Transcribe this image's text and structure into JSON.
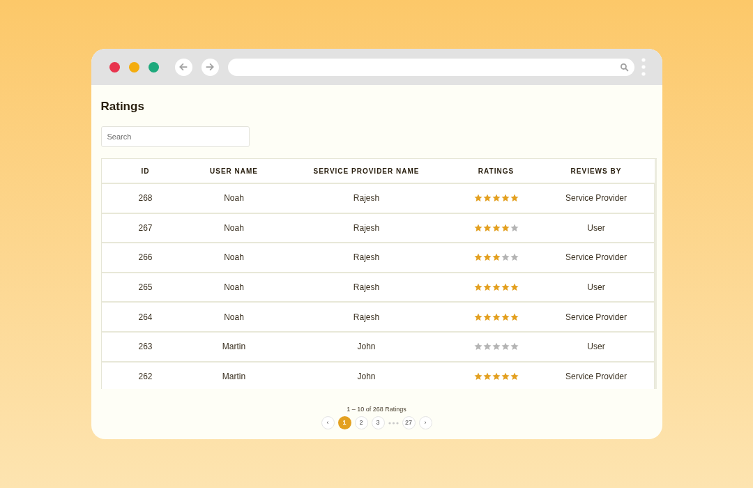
{
  "page": {
    "title": "Ratings"
  },
  "search": {
    "placeholder": "Search"
  },
  "table": {
    "columns": [
      "ID",
      "USER NAME",
      "SERVICE PROVIDER NAME",
      "RATINGS",
      "REVIEWS BY"
    ],
    "rows": [
      {
        "id": "268",
        "user": "Noah",
        "provider": "Rajesh",
        "stars": 5,
        "reviews_by": "Service Provider"
      },
      {
        "id": "267",
        "user": "Noah",
        "provider": "Rajesh",
        "stars": 4,
        "reviews_by": "User"
      },
      {
        "id": "266",
        "user": "Noah",
        "provider": "Rajesh",
        "stars": 3,
        "reviews_by": "Service Provider"
      },
      {
        "id": "265",
        "user": "Noah",
        "provider": "Rajesh",
        "stars": 5,
        "reviews_by": "User"
      },
      {
        "id": "264",
        "user": "Noah",
        "provider": "Rajesh",
        "stars": 5,
        "reviews_by": "Service Provider"
      },
      {
        "id": "263",
        "user": "Martin",
        "provider": "John",
        "stars": 0,
        "reviews_by": "User"
      },
      {
        "id": "262",
        "user": "Martin",
        "provider": "John",
        "stars": 5,
        "reviews_by": "Service Provider"
      }
    ]
  },
  "pagination": {
    "summary": "1 – 10 of 268 Ratings",
    "prev": "‹",
    "next": "›",
    "items": [
      {
        "kind": "page",
        "label": "1",
        "selected": true
      },
      {
        "kind": "page",
        "label": "2",
        "selected": false
      },
      {
        "kind": "page",
        "label": "3",
        "selected": false
      },
      {
        "kind": "ellipsis"
      },
      {
        "kind": "page",
        "label": "27",
        "selected": false
      }
    ]
  }
}
